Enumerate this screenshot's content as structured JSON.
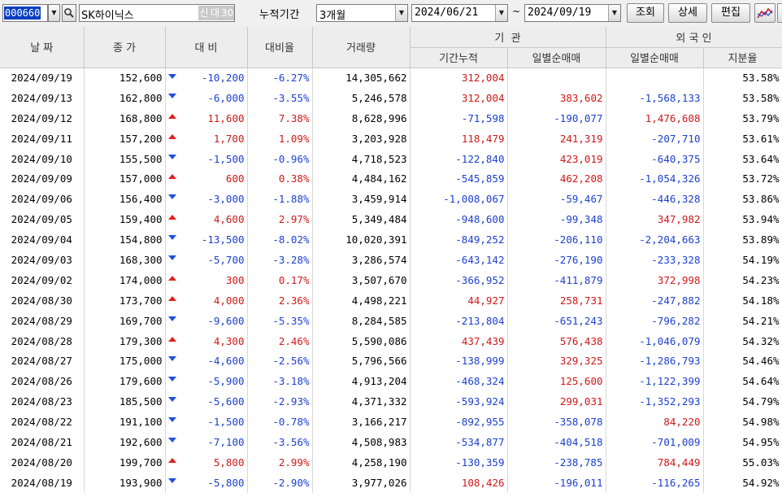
{
  "toolbar": {
    "stock_code": "000660",
    "stock_name": "SK하이닉스",
    "tag_new": "신",
    "tag_credit": "대",
    "tag_ratio": "30",
    "period_label": "누적기간",
    "period_value": "3개월",
    "start_date": "2024/06/21",
    "tilde": "~",
    "end_date": "2024/09/19",
    "query_label": "조회",
    "detail_label": "상세",
    "edit_label": "편집",
    "icons": {
      "code_dropdown": "chevron-down-icon",
      "search": "search-icon",
      "chart": "chart-icon"
    }
  },
  "colors": {
    "up": "#d01818",
    "down": "#1c3fd0",
    "header_bg": "#ededed",
    "selection": "#0a3fbf"
  },
  "headers": {
    "date": "날 짜",
    "price": "종 가",
    "change": "대 비",
    "change_rate": "대비율",
    "volume": "거래량",
    "institution": "기  관",
    "inst_cum": "기간누적",
    "inst_daily": "일별순매매",
    "foreign": "외 국 인",
    "foreign_daily": "일별순매매",
    "foreign_share": "지분율"
  },
  "rows": [
    {
      "date": "2024/09/19",
      "price": "152,600",
      "dir": "down",
      "change": "-10,200",
      "rate": "-6.27%",
      "volume": "14,305,662",
      "inst_cum": "312,004",
      "inst_daily": "",
      "frgn_daily": "",
      "share": "53.58%"
    },
    {
      "date": "2024/09/13",
      "price": "162,800",
      "dir": "down",
      "change": "-6,000",
      "rate": "-3.55%",
      "volume": "5,246,578",
      "inst_cum": "312,004",
      "inst_daily": "383,602",
      "frgn_daily": "-1,568,133",
      "share": "53.58%"
    },
    {
      "date": "2024/09/12",
      "price": "168,800",
      "dir": "up",
      "change": "11,600",
      "rate": "7.38%",
      "volume": "8,628,996",
      "inst_cum": "-71,598",
      "inst_daily": "-190,077",
      "frgn_daily": "1,476,608",
      "share": "53.79%"
    },
    {
      "date": "2024/09/11",
      "price": "157,200",
      "dir": "up",
      "change": "1,700",
      "rate": "1.09%",
      "volume": "3,203,928",
      "inst_cum": "118,479",
      "inst_daily": "241,319",
      "frgn_daily": "-207,710",
      "share": "53.61%"
    },
    {
      "date": "2024/09/10",
      "price": "155,500",
      "dir": "down",
      "change": "-1,500",
      "rate": "-0.96%",
      "volume": "4,718,523",
      "inst_cum": "-122,840",
      "inst_daily": "423,019",
      "frgn_daily": "-640,375",
      "share": "53.64%"
    },
    {
      "date": "2024/09/09",
      "price": "157,000",
      "dir": "up",
      "change": "600",
      "rate": "0.38%",
      "volume": "4,484,162",
      "inst_cum": "-545,859",
      "inst_daily": "462,208",
      "frgn_daily": "-1,054,326",
      "share": "53.72%"
    },
    {
      "date": "2024/09/06",
      "price": "156,400",
      "dir": "down",
      "change": "-3,000",
      "rate": "-1.88%",
      "volume": "3,459,914",
      "inst_cum": "-1,008,067",
      "inst_daily": "-59,467",
      "frgn_daily": "-446,328",
      "share": "53.86%"
    },
    {
      "date": "2024/09/05",
      "price": "159,400",
      "dir": "up",
      "change": "4,600",
      "rate": "2.97%",
      "volume": "5,349,484",
      "inst_cum": "-948,600",
      "inst_daily": "-99,348",
      "frgn_daily": "347,982",
      "share": "53.94%"
    },
    {
      "date": "2024/09/04",
      "price": "154,800",
      "dir": "down",
      "change": "-13,500",
      "rate": "-8.02%",
      "volume": "10,020,391",
      "inst_cum": "-849,252",
      "inst_daily": "-206,110",
      "frgn_daily": "-2,204,663",
      "share": "53.89%"
    },
    {
      "date": "2024/09/03",
      "price": "168,300",
      "dir": "down",
      "change": "-5,700",
      "rate": "-3.28%",
      "volume": "3,286,574",
      "inst_cum": "-643,142",
      "inst_daily": "-276,190",
      "frgn_daily": "-233,328",
      "share": "54.19%"
    },
    {
      "date": "2024/09/02",
      "price": "174,000",
      "dir": "up",
      "change": "300",
      "rate": "0.17%",
      "volume": "3,507,670",
      "inst_cum": "-366,952",
      "inst_daily": "-411,879",
      "frgn_daily": "372,998",
      "share": "54.23%"
    },
    {
      "date": "2024/08/30",
      "price": "173,700",
      "dir": "up",
      "change": "4,000",
      "rate": "2.36%",
      "volume": "4,498,221",
      "inst_cum": "44,927",
      "inst_daily": "258,731",
      "frgn_daily": "-247,882",
      "share": "54.18%"
    },
    {
      "date": "2024/08/29",
      "price": "169,700",
      "dir": "down",
      "change": "-9,600",
      "rate": "-5.35%",
      "volume": "8,284,585",
      "inst_cum": "-213,804",
      "inst_daily": "-651,243",
      "frgn_daily": "-796,282",
      "share": "54.21%"
    },
    {
      "date": "2024/08/28",
      "price": "179,300",
      "dir": "up",
      "change": "4,300",
      "rate": "2.46%",
      "volume": "5,590,086",
      "inst_cum": "437,439",
      "inst_daily": "576,438",
      "frgn_daily": "-1,046,079",
      "share": "54.32%"
    },
    {
      "date": "2024/08/27",
      "price": "175,000",
      "dir": "down",
      "change": "-4,600",
      "rate": "-2.56%",
      "volume": "5,796,566",
      "inst_cum": "-138,999",
      "inst_daily": "329,325",
      "frgn_daily": "-1,286,793",
      "share": "54.46%"
    },
    {
      "date": "2024/08/26",
      "price": "179,600",
      "dir": "down",
      "change": "-5,900",
      "rate": "-3.18%",
      "volume": "4,913,204",
      "inst_cum": "-468,324",
      "inst_daily": "125,600",
      "frgn_daily": "-1,122,399",
      "share": "54.64%"
    },
    {
      "date": "2024/08/23",
      "price": "185,500",
      "dir": "down",
      "change": "-5,600",
      "rate": "-2.93%",
      "volume": "4,371,332",
      "inst_cum": "-593,924",
      "inst_daily": "299,031",
      "frgn_daily": "-1,352,293",
      "share": "54.79%"
    },
    {
      "date": "2024/08/22",
      "price": "191,100",
      "dir": "down",
      "change": "-1,500",
      "rate": "-0.78%",
      "volume": "3,166,217",
      "inst_cum": "-892,955",
      "inst_daily": "-358,078",
      "frgn_daily": "84,220",
      "share": "54.98%"
    },
    {
      "date": "2024/08/21",
      "price": "192,600",
      "dir": "down",
      "change": "-7,100",
      "rate": "-3.56%",
      "volume": "4,508,983",
      "inst_cum": "-534,877",
      "inst_daily": "-404,518",
      "frgn_daily": "-701,009",
      "share": "54.95%"
    },
    {
      "date": "2024/08/20",
      "price": "199,700",
      "dir": "up",
      "change": "5,800",
      "rate": "2.99%",
      "volume": "4,258,190",
      "inst_cum": "-130,359",
      "inst_daily": "-238,785",
      "frgn_daily": "784,449",
      "share": "55.03%"
    },
    {
      "date": "2024/08/19",
      "price": "193,900",
      "dir": "down",
      "change": "-5,800",
      "rate": "-2.90%",
      "volume": "3,977,026",
      "inst_cum": "108,426",
      "inst_daily": "-196,011",
      "frgn_daily": "-116,265",
      "share": "54.92%"
    }
  ]
}
